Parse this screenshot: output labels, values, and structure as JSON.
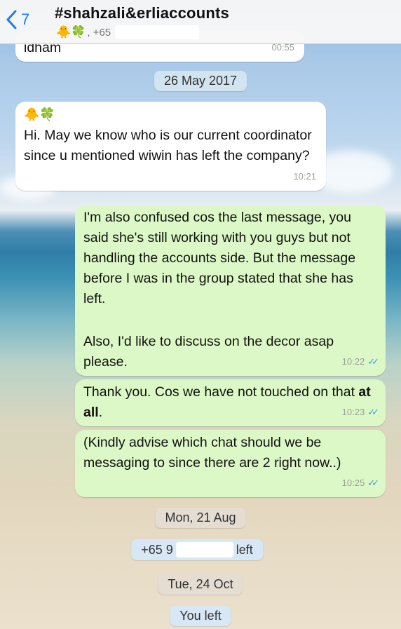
{
  "header": {
    "back_count": "7",
    "title": "#shahzali&erliaccounts",
    "subtitle_emojis": "🐥🍀",
    "subtitle_prefix": ", +65"
  },
  "messages": [
    {
      "type": "in",
      "text_tail": "idham",
      "time": "00:55"
    },
    {
      "type": "date",
      "label": "26 May 2017"
    },
    {
      "type": "in",
      "sender_emojis": "🐥🍀",
      "text": "Hi. May we know who is our current coordinator since u mentioned wiwin has left the company?",
      "time": "10:21"
    },
    {
      "type": "out",
      "text_para1": "I'm also confused cos the last message, you said she's still working with you guys but not handling the accounts side. But the message before I was in the group stated that she has left.",
      "text_para2": "Also, I'd like to discuss on the decor asap please.",
      "time": "10:22"
    },
    {
      "type": "out",
      "text_before": "Thank you. Cos we have not touched on that ",
      "text_bold": "at all",
      "text_after": ".",
      "time": "10:23"
    },
    {
      "type": "out",
      "text": "(Kindly advise which chat should we be messaging to since there are 2 right now..)",
      "time": "10:25"
    },
    {
      "type": "date",
      "label": "Mon, 21 Aug"
    },
    {
      "type": "system",
      "prefix": "+65 9",
      "suffix": "left"
    },
    {
      "type": "date",
      "label": "Tue, 24 Oct"
    },
    {
      "type": "system",
      "text": "You left"
    }
  ],
  "colors": {
    "accent": "#1a7cf5",
    "outgoing_bubble": "#dcf8c6",
    "incoming_bubble": "#ffffff",
    "read_ticks": "#3b9ee8"
  },
  "icons": {
    "back": "chevron-left-icon",
    "read": "double-check-icon"
  }
}
